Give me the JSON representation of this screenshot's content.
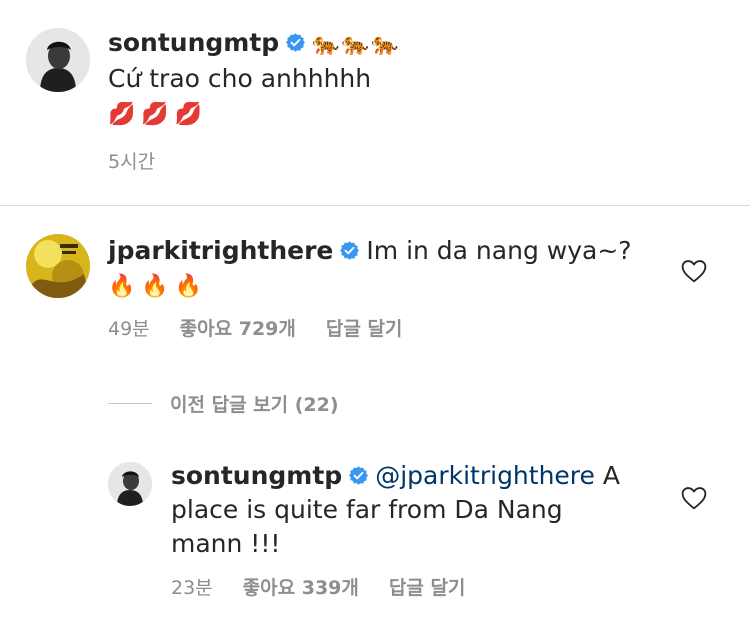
{
  "comments": [
    {
      "username": "sontungmtp",
      "verified": true,
      "header_emoji": "🐅🐅🐅",
      "text": "Cứ trao cho anhhhhh",
      "emoji_line": "💋💋💋",
      "time": "5시간"
    },
    {
      "username": "jparkitrighthere",
      "verified": true,
      "text": "Im in da nang wya~?",
      "emoji_line": "🔥🔥🔥",
      "time": "49분",
      "likes": "좋아요 729개",
      "reply_label": "답글 달기"
    }
  ],
  "view_replies": "이전 답글 보기 (22)",
  "reply": {
    "username": "sontungmtp",
    "verified": true,
    "mention": "@jparkitrighthere",
    "text_line1_rest": " A",
    "text_line2": "place is quite far from Da Nang",
    "text_line3": "mann !!!",
    "time": "23분",
    "likes": "좋아요 339개",
    "reply_label": "답글 달기"
  },
  "colors": {
    "text": "#262626",
    "meta": "#8e8e8e",
    "mention": "#003569",
    "verified": "#3897f0"
  },
  "icons": {
    "verified": "verified-badge-icon",
    "like": "heart-outline-icon"
  }
}
